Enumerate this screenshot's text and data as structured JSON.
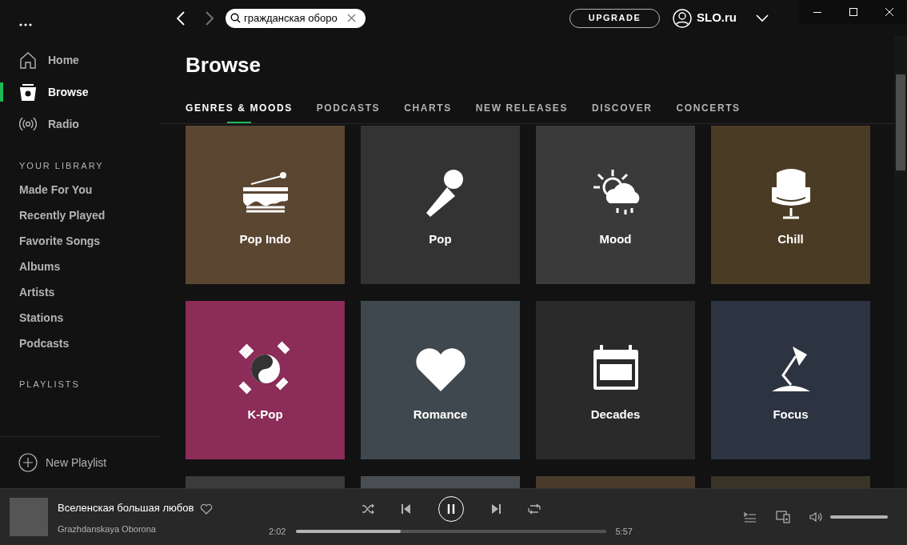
{
  "sidebar": {
    "nav": [
      {
        "label": "Home",
        "selected": false
      },
      {
        "label": "Browse",
        "selected": true
      },
      {
        "label": "Radio",
        "selected": false
      }
    ],
    "library_heading": "YOUR LIBRARY",
    "library": [
      "Made For You",
      "Recently Played",
      "Favorite Songs",
      "Albums",
      "Artists",
      "Stations",
      "Podcasts"
    ],
    "playlists_heading": "PLAYLISTS",
    "new_playlist": "New Playlist"
  },
  "topbar": {
    "search": {
      "value": "гражданская оборо"
    },
    "upgrade": "UPGRADE",
    "user": "SLO.ru"
  },
  "page": {
    "title": "Browse",
    "tabs": [
      {
        "label": "GENRES & MOODS",
        "selected": true
      },
      {
        "label": "PODCASTS",
        "selected": false
      },
      {
        "label": "CHARTS",
        "selected": false
      },
      {
        "label": "NEW RELEASES",
        "selected": false
      },
      {
        "label": "DISCOVER",
        "selected": false
      },
      {
        "label": "CONCERTS",
        "selected": false
      }
    ],
    "tiles": [
      {
        "label": "Pop Indo",
        "color": "#5b4632"
      },
      {
        "label": "Pop",
        "color": "#333333"
      },
      {
        "label": "Mood",
        "color": "#3a3a3a"
      },
      {
        "label": "Chill",
        "color": "#4a3c24"
      },
      {
        "label": "K-Pop",
        "color": "#8c2c58"
      },
      {
        "label": "Romance",
        "color": "#3e484e"
      },
      {
        "label": "Decades",
        "color": "#2a2a2a"
      },
      {
        "label": "Focus",
        "color": "#2c3441"
      },
      {
        "color": "#3b3b3b"
      },
      {
        "color": "#4a4e52"
      },
      {
        "color": "#4a3a2c"
      },
      {
        "color": "#3a3428"
      }
    ]
  },
  "player": {
    "title": "Вселенская большая любов",
    "artist": "Grazhdanskaya Oborona",
    "liked": false,
    "playing": true,
    "elapsed": "2:02",
    "level": 0.34,
    "duration": "5:57",
    "volume": {
      "level": 1
    }
  }
}
